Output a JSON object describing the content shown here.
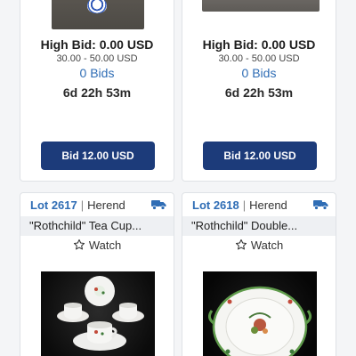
{
  "cards_top": [
    {
      "high_bid": "High Bid: 0.00 USD",
      "estimate": "30.00 - 50.00 USD",
      "bids": "0 Bids",
      "timer": "6d 22h 53m",
      "bid_button": "Bid 12.00 USD"
    },
    {
      "high_bid": "High Bid: 0.00 USD",
      "estimate": "30.00 - 50.00 USD",
      "bids": "0 Bids",
      "timer": "6d 22h 53m",
      "bid_button": "Bid 12.00 USD"
    }
  ],
  "cards_bottom": [
    {
      "lot": "Lot 2617",
      "separator": "|",
      "brand": "Herend",
      "title": "\"Rothchild\" Tea Cup...",
      "watch": "Watch",
      "shipping_icon": "truck-icon",
      "watch_icon": "star-outline-icon"
    },
    {
      "lot": "Lot 2618",
      "separator": "|",
      "brand": "Herend",
      "title": "\"Rothchild\" Double...",
      "watch": "Watch",
      "shipping_icon": "truck-icon",
      "watch_icon": "star-outline-icon"
    }
  ],
  "colors": {
    "accent_link": "#2f6db5",
    "bid_button": "#1c3b7a",
    "truck": "#2f6db5"
  }
}
